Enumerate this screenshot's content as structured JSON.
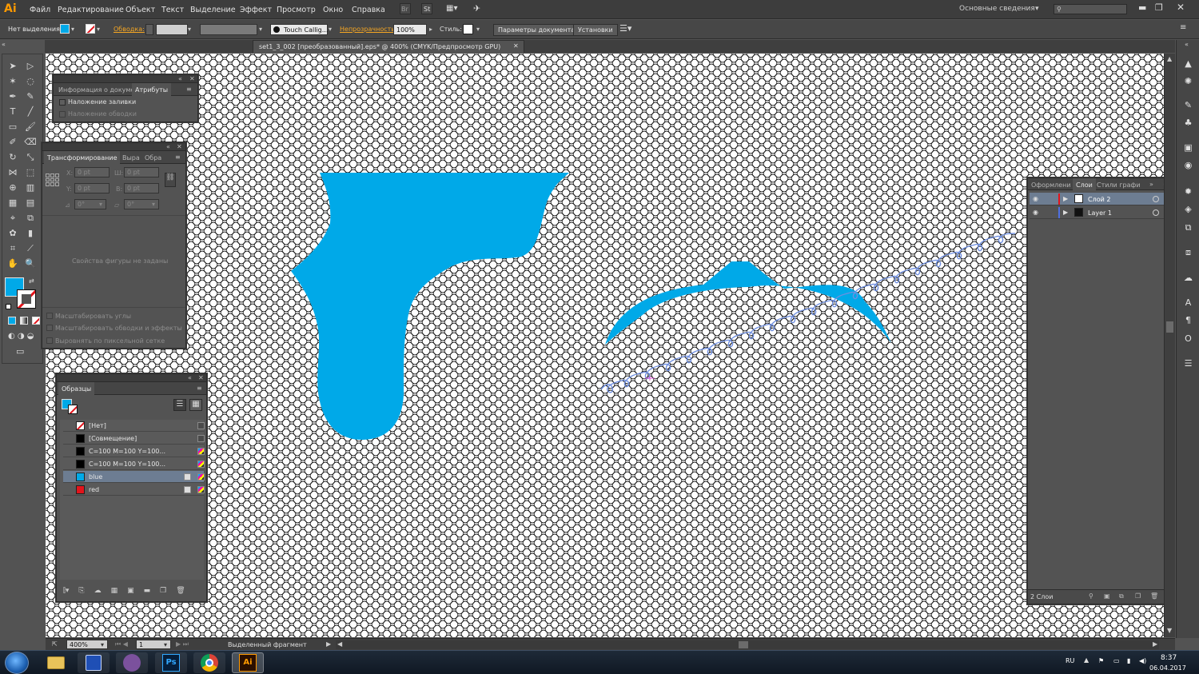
{
  "app": {
    "logo": "Ai",
    "menu": [
      "Файл",
      "Редактирование",
      "Объект",
      "Текст",
      "Выделение",
      "Эффект",
      "Просмотр",
      "Окно",
      "Справка"
    ],
    "bridge_label": "Br",
    "stock_label": "St",
    "workspace": "Основные сведения",
    "search_placeholder": ""
  },
  "control_bar": {
    "selection": "Нет выделения",
    "stroke_label": "Обводка:",
    "brush": "Touch Callig...",
    "opacity_label": "Непрозрачность:",
    "opacity_value": "100%",
    "style_label": "Стиль:",
    "doc_settings_button": "Параметры документа",
    "preferences_button": "Установки"
  },
  "document_tab": {
    "title": "set1_3_002 [преобразованный].eps* @ 400% (CMYK/Предпросмотр GPU)"
  },
  "attributes_panel": {
    "tabs": [
      "Информация о докуме",
      "Атрибуты"
    ],
    "overprint_fill": "Наложение заливки",
    "overprint_stroke": "Наложение обводки"
  },
  "transform_panel": {
    "tabs": [
      "Трансформирование",
      "Выра",
      "Обра"
    ],
    "x_label": "X:",
    "x_value": "0 pt",
    "w_label": "Ш:",
    "w_value": "0 pt",
    "y_label": "Y:",
    "y_value": "0 pt",
    "h_label": "В:",
    "h_value": "0 pt",
    "angle_value": "0°",
    "shear_value": "0°",
    "no_shape_props": "Свойства фигуры не заданы",
    "scale_corners": "Масштабировать углы",
    "scale_strokes": "Масштабировать обводки и эффекты",
    "align_pixel": "Выровнять по пиксельной сетке"
  },
  "swatches_panel": {
    "title": "Образцы",
    "items": [
      {
        "name": "[Нет]",
        "color": "none"
      },
      {
        "name": "[Совмещение]",
        "color": "#000000"
      },
      {
        "name": "C=100 M=100 Y=100...",
        "color": "#000000"
      },
      {
        "name": "C=100 M=100 Y=100...",
        "color": "#000000"
      },
      {
        "name": "blue",
        "color": "#00a9e8"
      },
      {
        "name": "red",
        "color": "#e3141b"
      }
    ]
  },
  "layers_panel": {
    "tabs": [
      "Оформлени",
      "Слои",
      "Стили графи"
    ],
    "layers": [
      {
        "name": "Слой 2",
        "color": "#e3141b"
      },
      {
        "name": "Layer 1",
        "color": "#4f6fe0"
      }
    ],
    "count": "2 Слои"
  },
  "status_bar": {
    "zoom": "400%",
    "artboard": "1",
    "tool_status": "Выделенный фрагмент"
  },
  "taskbar": {
    "apps": [
      "Windows Explorer",
      "Save",
      "Viber",
      "Photoshop",
      "Chrome",
      "Illustrator"
    ],
    "ps_label": "Ps",
    "ai_label": "Ai",
    "language": "RU",
    "time": "8:37",
    "date": "06.04.2017"
  },
  "colors": {
    "fill": "#00a9e8",
    "stroke": "#e3141b",
    "highlight": "#ff9a00"
  }
}
